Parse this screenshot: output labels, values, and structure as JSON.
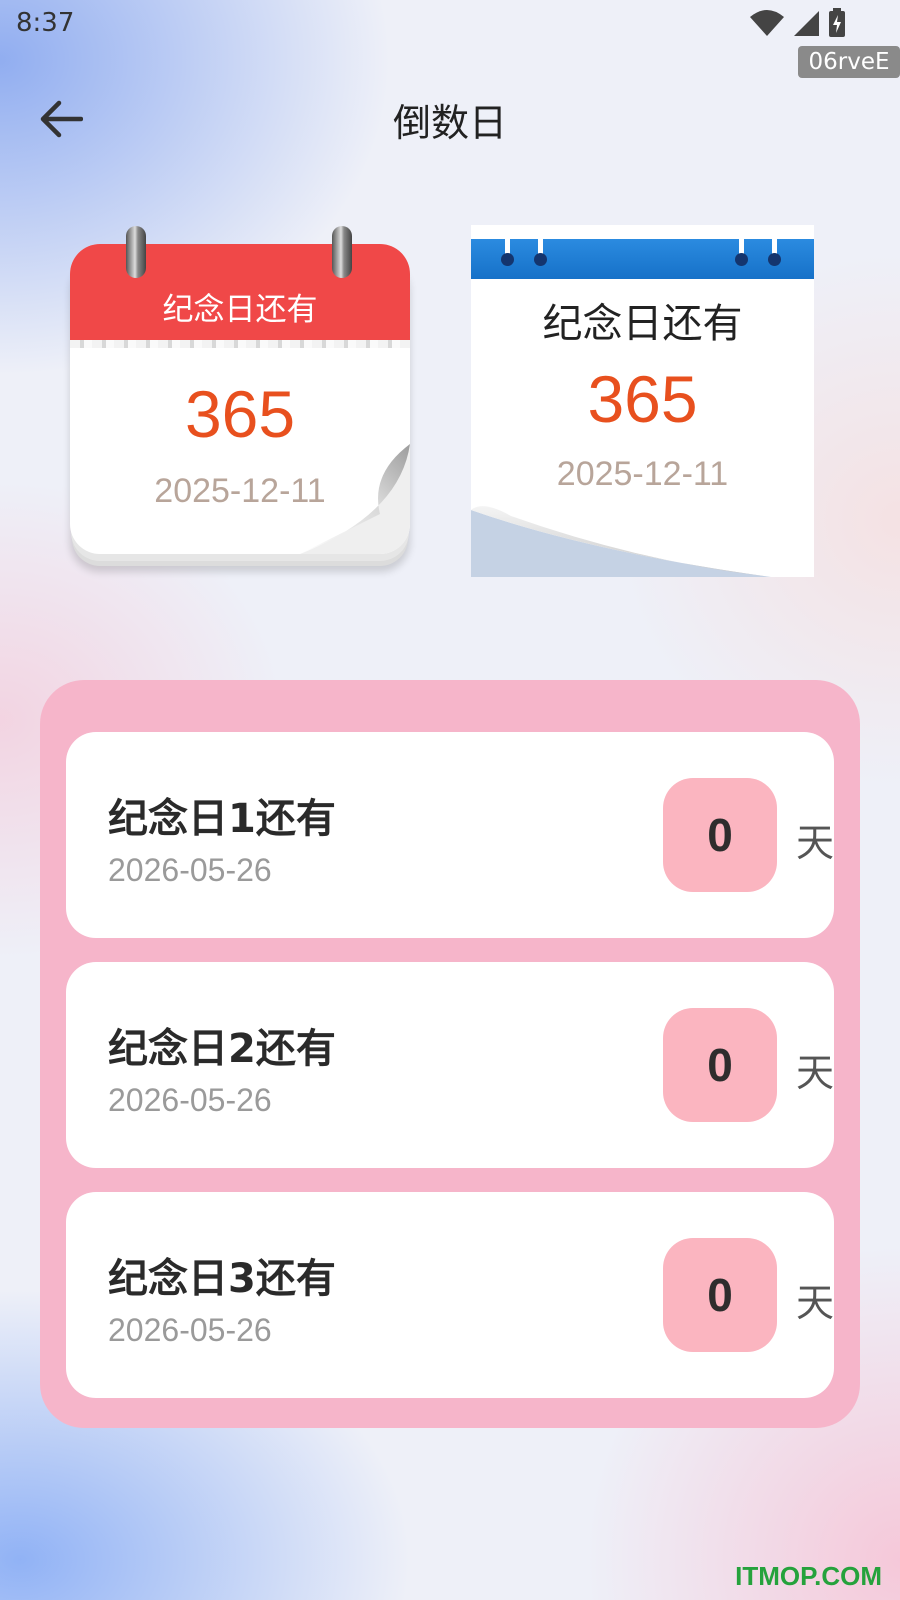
{
  "status_bar": {
    "time": "8:37",
    "tag": "06rveE"
  },
  "header": {
    "title": "倒数日"
  },
  "widgets": [
    {
      "label": "纪念日还有",
      "days": "365",
      "date": "2025-12-11",
      "accent": "#f04848"
    },
    {
      "label": "纪念日还有",
      "days": "365",
      "date": "2025-12-11",
      "accent": "#1e7fd8"
    }
  ],
  "list": {
    "unit_label": "天",
    "items": [
      {
        "title": "纪念日1还有",
        "date": "2026-05-26",
        "days": "0"
      },
      {
        "title": "纪念日2还有",
        "date": "2026-05-26",
        "days": "0"
      },
      {
        "title": "纪念日3还有",
        "date": "2026-05-26",
        "days": "0"
      }
    ]
  },
  "colors": {
    "panel": "#f6b5ca",
    "badge": "#fbb5c0",
    "number": "#e8501e"
  },
  "watermark": "ITMOP.COM"
}
